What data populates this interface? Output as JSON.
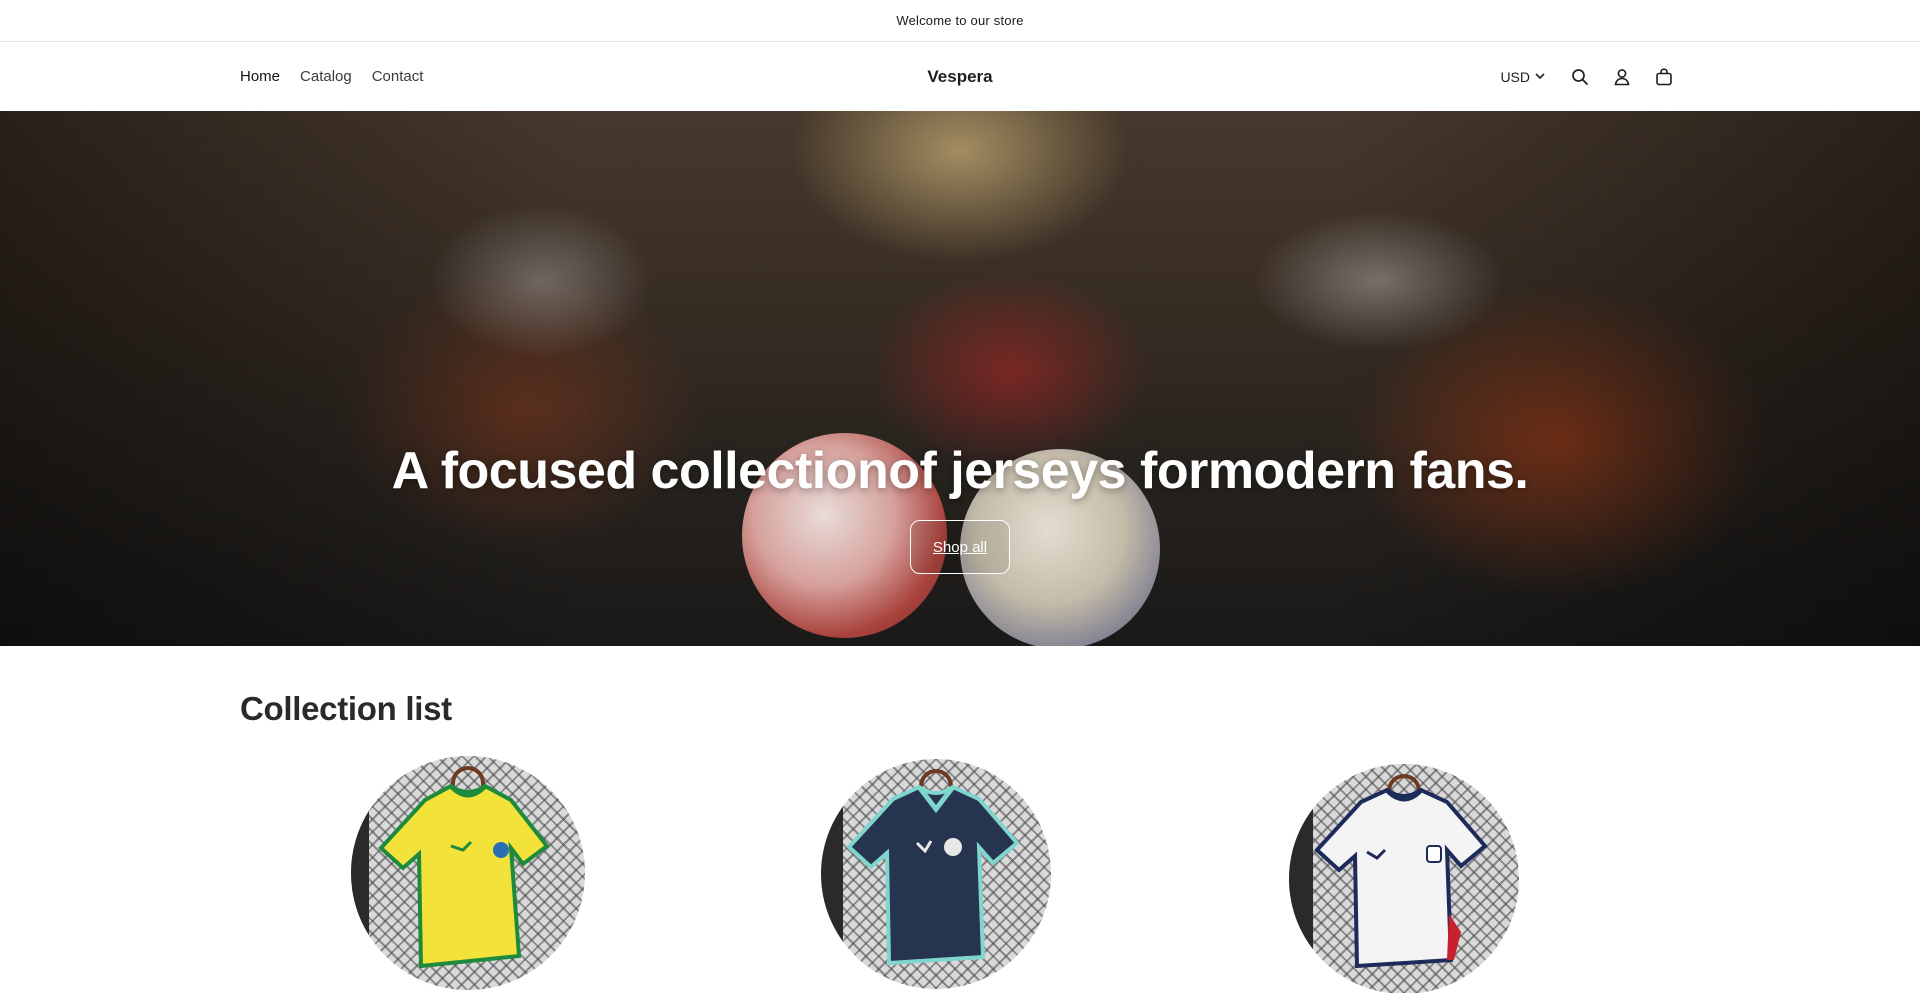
{
  "announcement": "Welcome to our store",
  "nav": {
    "home": "Home",
    "catalog": "Catalog",
    "contact": "Contact"
  },
  "brand": "Vespera",
  "currency": "USD",
  "icons": [
    "search-icon",
    "account-icon",
    "cart-icon",
    "chevron-down-icon"
  ],
  "hero": {
    "title": "A focused collectionof jerseys formodern fans.",
    "button": "Shop all"
  },
  "collection": {
    "title": "Collection list",
    "items": [
      {
        "name": "Yellow national team jersey",
        "color": "#f2e23a",
        "trim": "#1d8a3c"
      },
      {
        "name": "Navy national team jersey",
        "color": "#27344f",
        "trim": "#7fd6cf"
      },
      {
        "name": "White national team jersey",
        "color": "#f4f4f4",
        "trim": "#1d2b5a"
      }
    ]
  },
  "colors": {
    "text": "#121212",
    "border": "#e6e6e6",
    "hero_text": "#ffffff"
  }
}
